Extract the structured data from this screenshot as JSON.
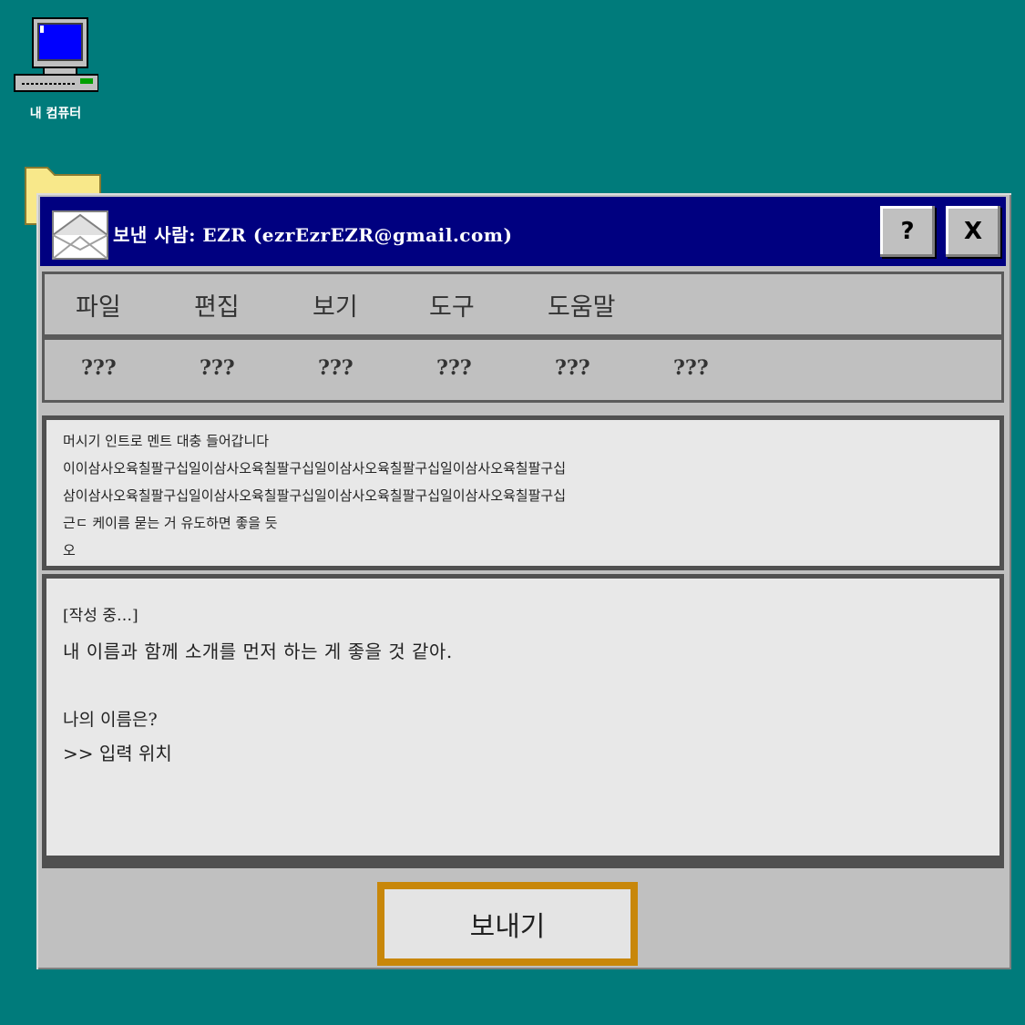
{
  "desktop": {
    "computer_label": "내 컴퓨터"
  },
  "window": {
    "title": "보낸 사람: EZR (ezrEzrEZR@gmail.com)",
    "help_label": "?",
    "close_label": "X",
    "menu": [
      "파일",
      "편집",
      "보기",
      "도구",
      "도움말"
    ],
    "toolbar": [
      "???",
      "???",
      "???",
      "???",
      "???",
      "???"
    ],
    "received_lines": [
      "머시기 인트로 멘트 대충 들어갑니다",
      "이이삼사오육칠팔구십일이삼사오육칠팔구십일이삼사오육칠팔구십일이삼사오육칠팔구십",
      "삼이삼사오육칠팔구십일이삼사오육칠팔구십일이삼사오육칠팔구십일이삼사오육칠팔구십",
      "근ㄷ 케이름 묻는 거 유도하면 좋을 듯",
      "오"
    ],
    "compose": {
      "status": "[작성 중…]",
      "intro": "내 이름과 함께 소개를 먼저 하는 게 좋을 것 같아.",
      "question": "나의 이름은?",
      "input_line": ">> 입력 위치"
    },
    "send_label": "보내기"
  },
  "colors": {
    "desktop": "#007b7b",
    "titlebar": "#000080",
    "window": "#c0c0c0",
    "send_border": "#c8870a"
  }
}
